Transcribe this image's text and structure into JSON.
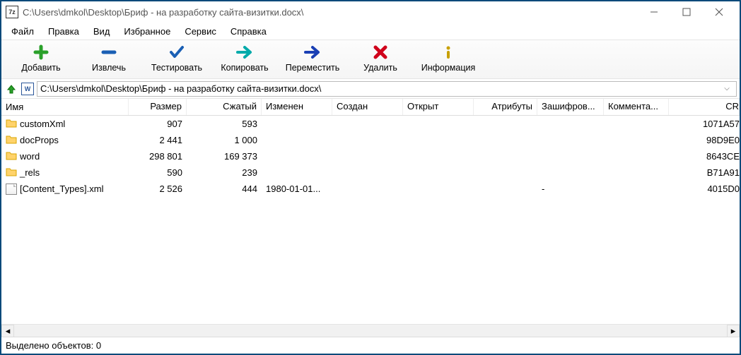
{
  "title": "C:\\Users\\dmkol\\Desktop\\Бриф - на разработку сайта-визитки.docx\\",
  "menu": [
    "Файл",
    "Правка",
    "Вид",
    "Избранное",
    "Сервис",
    "Справка"
  ],
  "toolbar": [
    {
      "name": "add-button",
      "label": "Добавить",
      "icon": "plus",
      "color": "#2aa02a"
    },
    {
      "name": "extract-button",
      "label": "Извлечь",
      "icon": "minus",
      "color": "#1a5fb4"
    },
    {
      "name": "test-button",
      "label": "Тестировать",
      "icon": "check",
      "color": "#1a5fb4"
    },
    {
      "name": "copy-button",
      "label": "Копировать",
      "icon": "arrow-right-teal",
      "color": "#0aa"
    },
    {
      "name": "move-button",
      "label": "Переместить",
      "icon": "arrow-right-blue",
      "color": "#1a3fb4"
    },
    {
      "name": "delete-button",
      "label": "Удалить",
      "icon": "x",
      "color": "#d0021b"
    },
    {
      "name": "info-button",
      "label": "Информация",
      "icon": "info",
      "color": "#c8a000"
    }
  ],
  "address": "C:\\Users\\dmkol\\Desktop\\Бриф - на разработку сайта-визитки.docx\\",
  "columns": [
    "Имя",
    "Размер",
    "Сжатый",
    "Изменен",
    "Создан",
    "Открыт",
    "Атрибуты",
    "Зашифров...",
    "Коммента...",
    "CR"
  ],
  "rows": [
    {
      "icon": "folder",
      "name": "customXml",
      "size": "907",
      "packed": "593",
      "mod": "",
      "crt": "",
      "open": "",
      "attr": "",
      "enc": "",
      "comm": "",
      "crc": "1071A57"
    },
    {
      "icon": "folder",
      "name": "docProps",
      "size": "2 441",
      "packed": "1 000",
      "mod": "",
      "crt": "",
      "open": "",
      "attr": "",
      "enc": "",
      "comm": "",
      "crc": "98D9E0"
    },
    {
      "icon": "folder",
      "name": "word",
      "size": "298 801",
      "packed": "169 373",
      "mod": "",
      "crt": "",
      "open": "",
      "attr": "",
      "enc": "",
      "comm": "",
      "crc": "8643CE"
    },
    {
      "icon": "folder",
      "name": "_rels",
      "size": "590",
      "packed": "239",
      "mod": "",
      "crt": "",
      "open": "",
      "attr": "",
      "enc": "",
      "comm": "",
      "crc": "B71A91"
    },
    {
      "icon": "file",
      "name": "[Content_Types].xml",
      "size": "2 526",
      "packed": "444",
      "mod": "1980-01-01...",
      "crt": "",
      "open": "",
      "attr": "",
      "enc": "-",
      "comm": "",
      "crc": "4015D0"
    }
  ],
  "status": "Выделено объектов: 0"
}
